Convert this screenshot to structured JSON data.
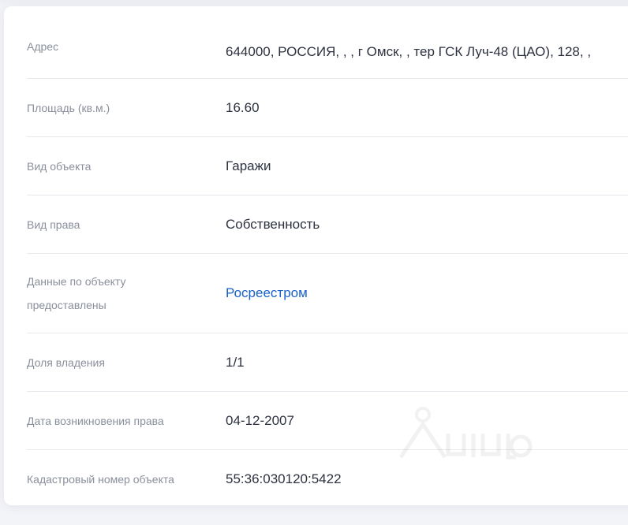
{
  "rows": [
    {
      "label": "Адрес",
      "value": "644000, РОССИЯ, , , г Омск, , тер ГСК Луч-48 (ЦАО), 128, ,"
    },
    {
      "label": "Площадь (кв.м.)",
      "value": "16.60"
    },
    {
      "label": "Вид объекта",
      "value": "Гаражи"
    },
    {
      "label": "Вид права",
      "value": "Собственность"
    },
    {
      "label": "Данные по объекту предоставлены",
      "value": "Росреестром"
    },
    {
      "label": "Доля владения",
      "value": "1/1"
    },
    {
      "label": "Дата возникновения права",
      "value": "04-12-2007"
    },
    {
      "label": "Кадастровый номер объекта",
      "value": "55:36:030120:5422"
    }
  ],
  "colors": {
    "label": "#8a8f9c",
    "value": "#2d3240",
    "link": "#1a61c9",
    "divider": "#e6e8ee"
  },
  "watermark_icon": "cian-logo-watermark"
}
